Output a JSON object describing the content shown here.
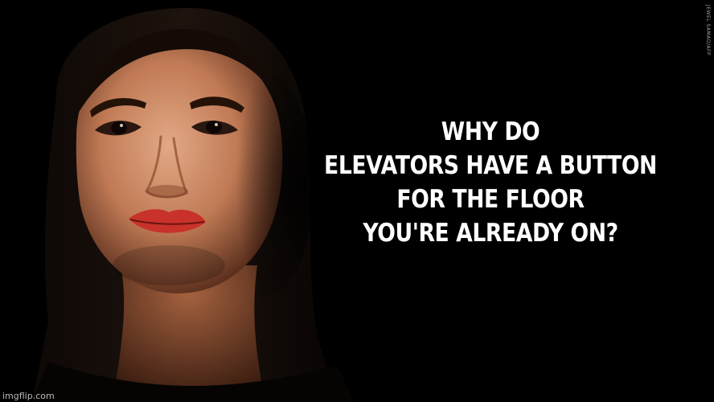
{
  "meme": {
    "caption_lines": [
      "WHY DO",
      "ELEVATORS HAVE A BUTTON",
      "FOR THE FLOOR",
      "YOU'RE ALREADY ON?"
    ],
    "photo_credit": "JEWEL SAMAD/AFP",
    "watermark": "imgflip.com"
  },
  "colors": {
    "background": "#000000",
    "caption_text": "#ffffff",
    "lips": "#c8322a",
    "skin": "#c98b66"
  }
}
